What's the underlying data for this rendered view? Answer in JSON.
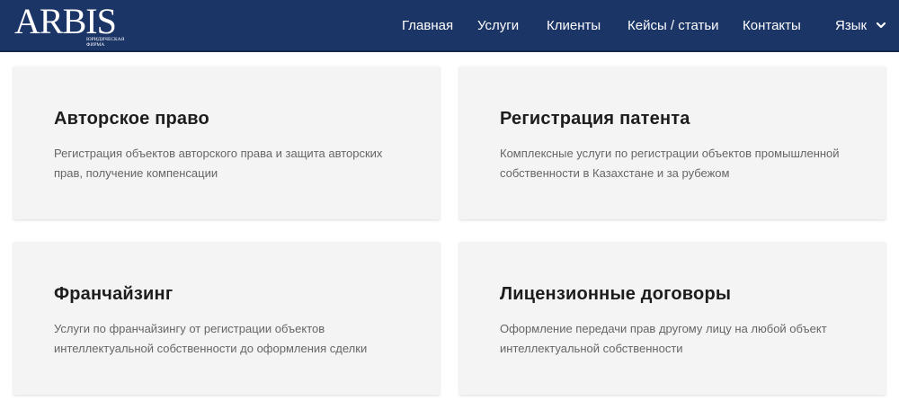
{
  "header": {
    "logo_text": "ARBIS",
    "logo_subtitle": "юридическая фирма",
    "nav": [
      {
        "label": "Главная"
      },
      {
        "label": "Услуги"
      },
      {
        "label": "Клиенты"
      },
      {
        "label": "Кейсы / статьи"
      },
      {
        "label": "Контакты"
      }
    ],
    "language_label": "Язык",
    "language_icon": "chevron-down-icon"
  },
  "services": [
    {
      "title": "Авторское право",
      "description": "Регистрация объектов авторского права и защита авторских прав, получение компенсации"
    },
    {
      "title": "Регистрация патента",
      "description": "Комплексные услуги по регистрации объектов промышленной собственности в Казахстане и за рубежом"
    },
    {
      "title": "Франчайзинг",
      "description": "Услуги по франчайзингу от регистрации объектов интеллектуальной собственности до оформления сделки"
    },
    {
      "title": "Лицензионные договоры",
      "description": "Оформление передачи прав другому лицу на любой объект интеллектуальной собственности"
    }
  ],
  "colors": {
    "header_bg": "#1c3567",
    "card_bg": "#f4f4f4",
    "title_text": "#1d1d1d",
    "body_text": "#666666"
  }
}
